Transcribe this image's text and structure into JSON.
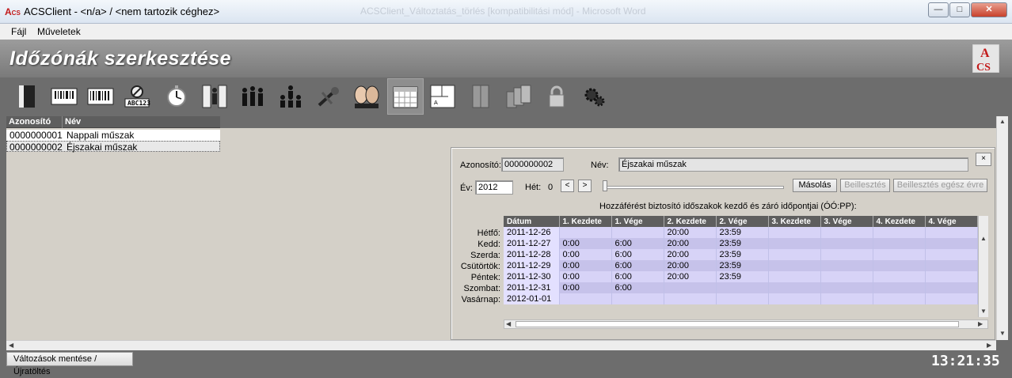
{
  "window": {
    "title": "ACSClient - <n/a> / <nem tartozik céghez>",
    "background_title": "ACSClient_Változtatás_törlés [kompatibilitási mód] - Microsoft Word",
    "minimize": "—",
    "maximize": "□",
    "close": "✕"
  },
  "menu": {
    "file": "Fájl",
    "operations": "Műveletek"
  },
  "header": {
    "title": "Időzónák szerkesztése",
    "logo_top": "A",
    "logo_bottom": "CS"
  },
  "toolbar": {
    "icons": [
      "door-icon",
      "barcode-reader-icon",
      "barcode-reader-2-icon",
      "card-forbidden-icon",
      "stopwatch-icon",
      "doors-icon",
      "group-icon",
      "group-hierarchy-icon",
      "tools-icon",
      "faces-icon",
      "calendar-icon",
      "floorplan-icon",
      "cabinet-icon",
      "multi-cabinet-icon",
      "lock-icon",
      "gears-icon"
    ]
  },
  "list": {
    "col_id": "Azonosító",
    "col_name": "Név",
    "rows": [
      {
        "id": "0000000001",
        "name": "Nappali műszak"
      },
      {
        "id": "0000000002",
        "name": "Éjszakai műszak"
      }
    ]
  },
  "panel": {
    "id_label": "Azonosító:",
    "id_value": "0000000002",
    "name_label": "Név:",
    "name_value": "Éjszakai műszak",
    "close": "×",
    "year_label": "Év:",
    "year_value": "2012",
    "week_label": "Hét:",
    "week_value": "0",
    "prev": "<",
    "next": ">",
    "copy": "Másolás",
    "paste": "Beillesztés",
    "paste_year": "Beillesztés egész évre",
    "caption": "Hozzáférést biztosító időszakok kezdő és záró időpontjai (ÓÓ:PP):"
  },
  "week_table": {
    "headers": [
      "Dátum",
      "1. Kezdete",
      "1. Vége",
      "2. Kezdete",
      "2. Vége",
      "3. Kezdete",
      "3. Vége",
      "4. Kezdete",
      "4. Vége"
    ],
    "rows": [
      {
        "day": "Hétfő:",
        "cells": [
          "2011-12-26",
          "",
          "",
          "20:00",
          "23:59",
          "",
          "",
          "",
          ""
        ]
      },
      {
        "day": "Kedd:",
        "cells": [
          "2011-12-27",
          "0:00",
          "6:00",
          "20:00",
          "23:59",
          "",
          "",
          "",
          ""
        ]
      },
      {
        "day": "Szerda:",
        "cells": [
          "2011-12-28",
          "0:00",
          "6:00",
          "20:00",
          "23:59",
          "",
          "",
          "",
          ""
        ]
      },
      {
        "day": "Csütörtök:",
        "cells": [
          "2011-12-29",
          "0:00",
          "6:00",
          "20:00",
          "23:59",
          "",
          "",
          "",
          ""
        ]
      },
      {
        "day": "Péntek:",
        "cells": [
          "2011-12-30",
          "0:00",
          "6:00",
          "20:00",
          "23:59",
          "",
          "",
          "",
          ""
        ]
      },
      {
        "day": "Szombat:",
        "cells": [
          "2011-12-31",
          "0:00",
          "6:00",
          "",
          "",
          "",
          "",
          "",
          ""
        ]
      },
      {
        "day": "Vasárnap:",
        "cells": [
          "2012-01-01",
          "",
          "",
          "",
          "",
          "",
          "",
          "",
          ""
        ]
      }
    ]
  },
  "status": {
    "save_button": "Változások mentése / Újratöltés",
    "clock": "13:21:35"
  }
}
